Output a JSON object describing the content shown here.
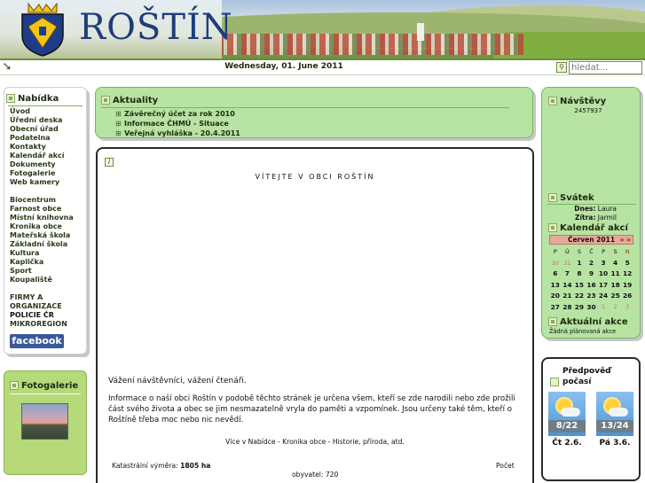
{
  "site": {
    "title": "ROŠTÍN"
  },
  "topbar": {
    "date": "Wednesday, 01. June 2011",
    "search_placeholder": "hledat..."
  },
  "menu": {
    "title": "Nabídka",
    "items": [
      "Úvod",
      "Úřední deska",
      "Obecní úřad",
      "Podatelna",
      "Kontakty",
      "Kalendář akcí",
      "Dokumenty",
      "Fotogalerie",
      "Web kamery"
    ],
    "items2": [
      "Biocentrum",
      "Farnost obce",
      "Místní knihovna",
      "Kronika obce",
      "Mateřská škola",
      "Základní škola",
      "Kultura",
      "Kaplička",
      "Sport",
      "Koupaliště"
    ],
    "items3": [
      "FIRMY A",
      "ORGANIZACE",
      "POLICIE ČR",
      "MIKROREGION"
    ],
    "facebook": "facebook"
  },
  "gallery": {
    "title": "Fotogalerie"
  },
  "news": {
    "title": "Aktuality",
    "items": [
      "Závěrečný účet za rok 2010",
      "Informace ČHMÚ - Situace",
      "Veřejná vyhláška - 20.4.2011"
    ]
  },
  "main": {
    "welcome": "VÍTEJTE V OBCI ROŠTÍN",
    "greeting": "Vážení návštěvníci, vážení čtenáři.",
    "paragraph": "Informace o naší obci Roštín v podobě těchto stránek je určena všem, kteří se zde narodili nebo zde prožili část svého života a obec se jim nesmazatelně vryla do paměti a vzpomínek. Jsou určeny také těm, kteří o Roštíně třeba moc nebo nic nevědí.",
    "more": "Více v Nabídce - Kronika obce - Historie, příroda, atd.",
    "area_label": "Katastrální výměra:",
    "area_value": "1805 ha",
    "pop_label": "Počet",
    "pop_text": "obyvatel: 720"
  },
  "visits": {
    "title": "Návštěvy",
    "count": "2457937"
  },
  "nameday": {
    "title": "Svátek",
    "today_label": "Dnes:",
    "today": "Laura",
    "tomorrow_label": "Zítra:",
    "tomorrow": "Jarmil"
  },
  "calendar": {
    "title": "Kalendář akcí",
    "month": "Červen 2011",
    "nav": "» »",
    "dow": [
      "P",
      "Ú",
      "S",
      "Č",
      "P",
      "S",
      "N"
    ],
    "weeks": [
      [
        "30",
        "31",
        "1",
        "2",
        "3",
        "4",
        "5"
      ],
      [
        "6",
        "7",
        "8",
        "9",
        "10",
        "11",
        "12"
      ],
      [
        "13",
        "14",
        "15",
        "16",
        "17",
        "18",
        "19"
      ],
      [
        "20",
        "21",
        "22",
        "23",
        "24",
        "25",
        "26"
      ],
      [
        "27",
        "28",
        "29",
        "30",
        "1",
        "2",
        "3"
      ]
    ]
  },
  "actions": {
    "title": "Aktuální akce",
    "empty": "Žádná plánovaná akce"
  },
  "weather": {
    "title": "Předpověď počasí",
    "days": [
      {
        "temp": "8/22",
        "label": "Čt 2.6."
      },
      {
        "temp": "13/24",
        "label": "Pá 3.6."
      }
    ]
  }
}
